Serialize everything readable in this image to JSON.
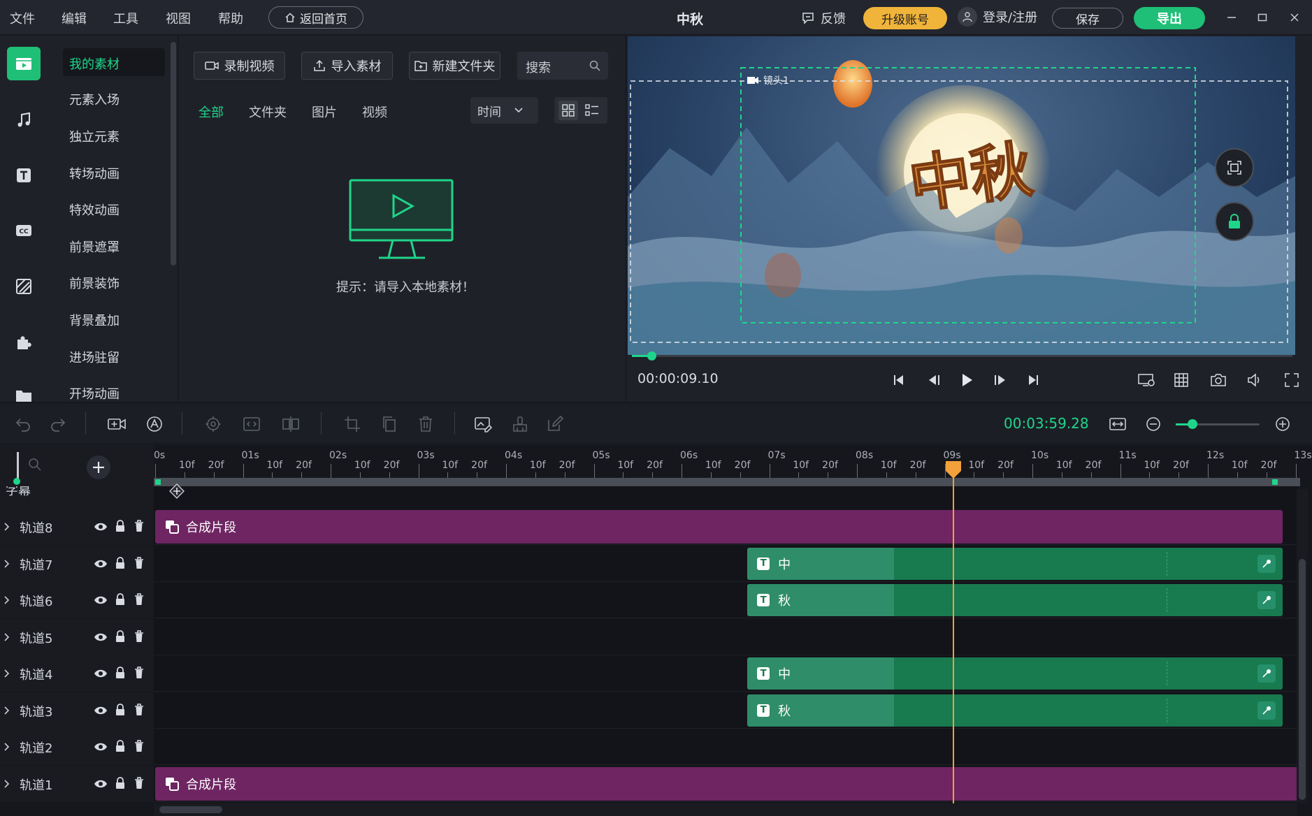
{
  "menu": [
    "文件",
    "编辑",
    "工具",
    "视图",
    "帮助"
  ],
  "header": {
    "home_button": "返回首页",
    "title": "中秋",
    "feedback": "反馈",
    "upgrade": "升级账号",
    "login": "登录/注册",
    "save": "保存",
    "export": "导出"
  },
  "rail_icons": [
    "media-icon",
    "music-icon",
    "text-icon",
    "subtitle-icon",
    "transition-icon",
    "plugin-icon",
    "folder-icon"
  ],
  "categories": [
    "我的素材",
    "元素入场",
    "独立元素",
    "转场动画",
    "特效动画",
    "前景遮罩",
    "前景装饰",
    "背景叠加",
    "进场驻留",
    "开场动画"
  ],
  "media": {
    "record": "录制视频",
    "import": "导入素材",
    "new_folder": "新建文件夹",
    "search_placeholder": "搜索",
    "tabs": [
      "全部",
      "文件夹",
      "图片",
      "视频"
    ],
    "sort": "时间",
    "hint": "提示：请导入本地素材！"
  },
  "preview": {
    "camera_label": "镜头1",
    "overlay_text": "中秋",
    "current_time": "00:00:09.10",
    "progress": 0.03
  },
  "timeline": {
    "total_time": "00:03:59.28",
    "zoom_level": 0.2,
    "ruler_seconds": [
      "0s",
      "01s",
      "02s",
      "03s",
      "04s",
      "05s",
      "06s",
      "07s",
      "08s",
      "09s",
      "10s",
      "11s",
      "12s",
      "13s"
    ],
    "ruler_minor": [
      "10f",
      "20f"
    ],
    "partial_track": "字幕",
    "playhead_seconds": 9.1,
    "tracks": [
      {
        "name": "轨道8",
        "clip_type": "composite",
        "label": "合成片段",
        "start": 0,
        "end": 12.85
      },
      {
        "name": "轨道7",
        "clip_type": "text",
        "label": "中",
        "start": 6.75,
        "end": 12.85
      },
      {
        "name": "轨道6",
        "clip_type": "text",
        "label": "秋",
        "start": 6.75,
        "end": 12.85
      },
      {
        "name": "轨道5",
        "clip_type": "empty",
        "label": ""
      },
      {
        "name": "轨道4",
        "clip_type": "text",
        "label": "中",
        "start": 6.75,
        "end": 12.85
      },
      {
        "name": "轨道3",
        "clip_type": "text",
        "label": "秋",
        "start": 6.75,
        "end": 12.85
      },
      {
        "name": "轨道2",
        "clip_type": "empty",
        "label": ""
      },
      {
        "name": "轨道1",
        "clip_type": "composite",
        "label": "合成片段",
        "start": 0,
        "end": 13.05
      }
    ]
  },
  "colors": {
    "accent": "#1fd58a",
    "upgrade": "#f0b43a",
    "export": "#1fbf77",
    "playhead": "#f3a13a",
    "composite_clip": "#6e2562",
    "text_clip": "#187a4f"
  }
}
